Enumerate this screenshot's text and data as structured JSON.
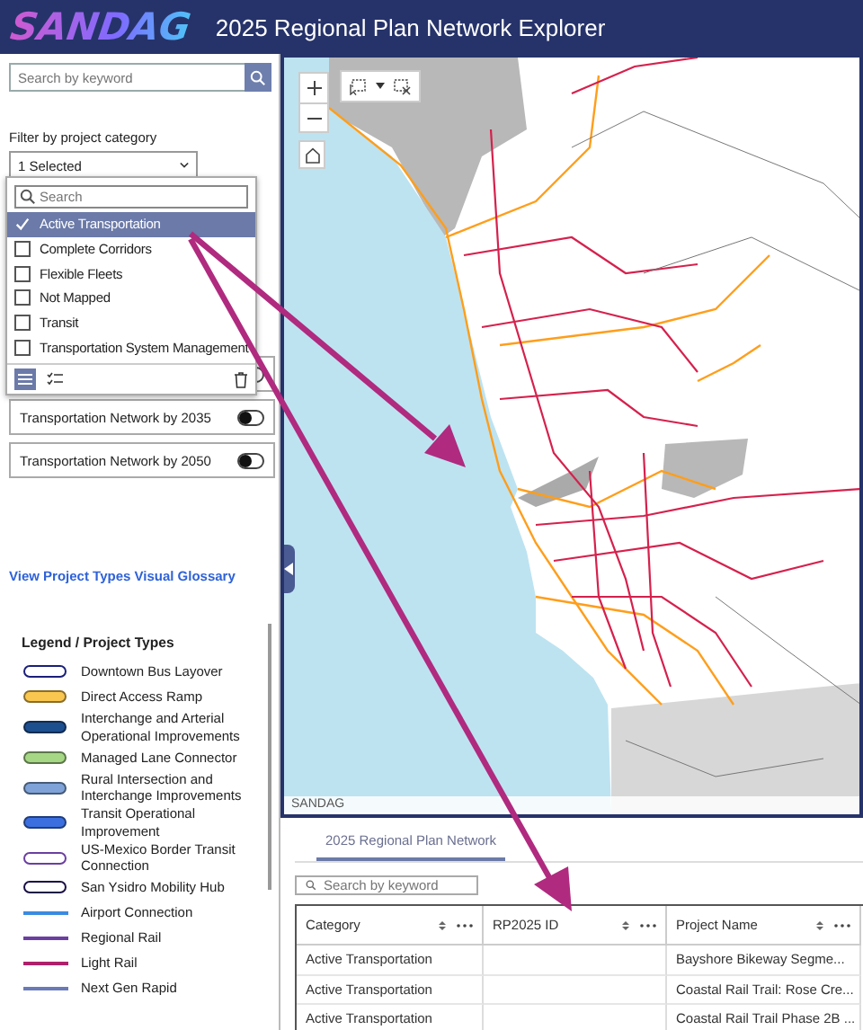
{
  "header": {
    "logo": "SANDAG",
    "title": "2025 Regional Plan Network Explorer"
  },
  "sidebar": {
    "search": {
      "placeholder": "Search by keyword"
    },
    "filter": {
      "label": "Filter by project category",
      "value": "1 Selected",
      "expanded": true,
      "search_placeholder": "Search",
      "options": [
        {
          "label": "Active Transportation",
          "checked": true
        },
        {
          "label": "Complete Corridors",
          "checked": false
        },
        {
          "label": "Flexible Fleets",
          "checked": false
        },
        {
          "label": "Not Mapped",
          "checked": false
        },
        {
          "label": "Transit",
          "checked": false
        },
        {
          "label": "Transportation System Management",
          "checked": false
        }
      ]
    },
    "toggles": [
      {
        "on": false
      },
      {
        "label": "Transportation Network by 2035",
        "on": false
      },
      {
        "label": "Transportation Network by 2050",
        "on": false
      }
    ],
    "glossary_link": "View Project Types Visual Glossary",
    "legend": {
      "title": "Legend / Project Types",
      "items": [
        {
          "label": "Downtown Bus Layover",
          "kind": "outline",
          "color": "#1b1f7a"
        },
        {
          "label": "Direct Access Ramp",
          "kind": "filled",
          "color": "#f9c74f"
        },
        {
          "label": "Interchange and Arterial Operational Improvements",
          "kind": "filled",
          "color": "#1d4f8f"
        },
        {
          "label": "Managed Lane Connector",
          "kind": "filled",
          "color": "#a6d785"
        },
        {
          "label": "Rural Intersection and Interchange Improvements",
          "kind": "filled",
          "color": "#7fa3d8"
        },
        {
          "label": "Transit Operational Improvement",
          "kind": "filled",
          "color": "#3b6fe0"
        },
        {
          "label": "US-Mexico Border Transit Connection",
          "kind": "outline",
          "color": "#6a3fa0"
        },
        {
          "label": "San Ysidro Mobility Hub",
          "kind": "outline",
          "color": "#1a1046"
        },
        {
          "label": "Airport Connection",
          "kind": "line",
          "color": "#3a8be0"
        },
        {
          "label": "Regional Rail",
          "kind": "line",
          "color": "#6b3fa0"
        },
        {
          "label": "Light Rail",
          "kind": "line",
          "color": "#b0206a"
        },
        {
          "label": "Next Gen Rapid",
          "kind": "line",
          "color": "#6a7ab8"
        }
      ]
    }
  },
  "map": {
    "attribution": "SANDAG"
  },
  "bottom": {
    "tabs": [
      {
        "label": "2025 Regional Plan Network",
        "selected": true
      }
    ],
    "search": {
      "placeholder": "Search by keyword"
    },
    "table": {
      "columns": [
        "Category",
        "RP2025 ID",
        "Project Name"
      ],
      "rows": [
        {
          "category": "Active Transportation",
          "project_name": "Bayshore Bikeway Segme..."
        },
        {
          "category": "Active Transportation",
          "project_name": "Coastal Rail Trail: Rose Cre..."
        },
        {
          "category": "Active Transportation",
          "project_name": "Coastal Rail Trail Phase 2B ..."
        }
      ]
    }
  }
}
